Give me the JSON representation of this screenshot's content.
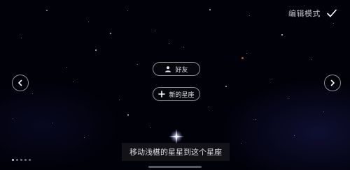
{
  "header": {
    "edit_mode_label": "编辑模式",
    "confirm_icon": "check-icon"
  },
  "navigation": {
    "prev_icon": "chevron-left-icon",
    "next_icon": "chevron-right-icon"
  },
  "actions": {
    "friends_label": "好友",
    "friends_icon": "person-icon",
    "new_constellation_label": "新的星座",
    "new_constellation_icon": "plus-icon"
  },
  "hint": {
    "text": "移动浅椹的星星到这个星座"
  },
  "page_indicator": {
    "count": 5,
    "active_index": 0
  },
  "colors": {
    "background": "#000000",
    "star": "#d8d8e8",
    "accent_star": "#c04a3a"
  }
}
